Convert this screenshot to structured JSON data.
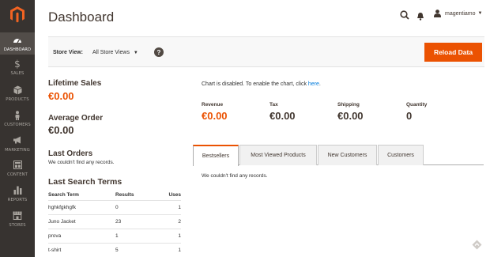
{
  "header": {
    "title": "Dashboard",
    "user": "magentiamo"
  },
  "sidebar": {
    "items": [
      {
        "label": "DASHBOARD",
        "icon": "dashboard-icon"
      },
      {
        "label": "SALES",
        "icon": "dollar-icon"
      },
      {
        "label": "PRODUCTS",
        "icon": "cube-icon"
      },
      {
        "label": "CUSTOMERS",
        "icon": "person-icon"
      },
      {
        "label": "MARKETING",
        "icon": "megaphone-icon"
      },
      {
        "label": "CONTENT",
        "icon": "content-icon"
      },
      {
        "label": "REPORTS",
        "icon": "bar-chart-icon"
      },
      {
        "label": "STORES",
        "icon": "store-icon"
      }
    ]
  },
  "store_bar": {
    "label": "Store View:",
    "selected": "All Store Views",
    "help": "?",
    "reload": "Reload Data"
  },
  "stats": {
    "lifetime_sales": {
      "label": "Lifetime Sales",
      "value": "€0.00"
    },
    "average_order": {
      "label": "Average Order",
      "value": "€0.00"
    }
  },
  "last_orders": {
    "title": "Last Orders",
    "empty": "We couldn't find any records."
  },
  "last_search": {
    "title": "Last Search Terms",
    "columns": [
      "Search Term",
      "Results",
      "Uses"
    ],
    "rows": [
      {
        "term": "hghkfgkhgfk",
        "results": "0",
        "uses": "1"
      },
      {
        "term": "Juno Jacket",
        "results": "23",
        "uses": "2"
      },
      {
        "term": "prova",
        "results": "1",
        "uses": "1"
      },
      {
        "term": "t-shirt",
        "results": "5",
        "uses": "1"
      }
    ]
  },
  "chart": {
    "message": "Chart is disabled. To enable the chart, click ",
    "link": "here",
    "period": "."
  },
  "totals": [
    {
      "label": "Revenue",
      "value": "€0.00"
    },
    {
      "label": "Tax",
      "value": "€0.00"
    },
    {
      "label": "Shipping",
      "value": "€0.00"
    },
    {
      "label": "Quantity",
      "value": "0"
    }
  ],
  "tabs": {
    "items": [
      "Bestsellers",
      "Most Viewed Products",
      "New Customers",
      "Customers"
    ],
    "active": "Bestsellers",
    "empty": "We couldn't find any records."
  },
  "colors": {
    "accent": "#eb5202",
    "sidebar": "#373330",
    "link": "#007bdb"
  }
}
